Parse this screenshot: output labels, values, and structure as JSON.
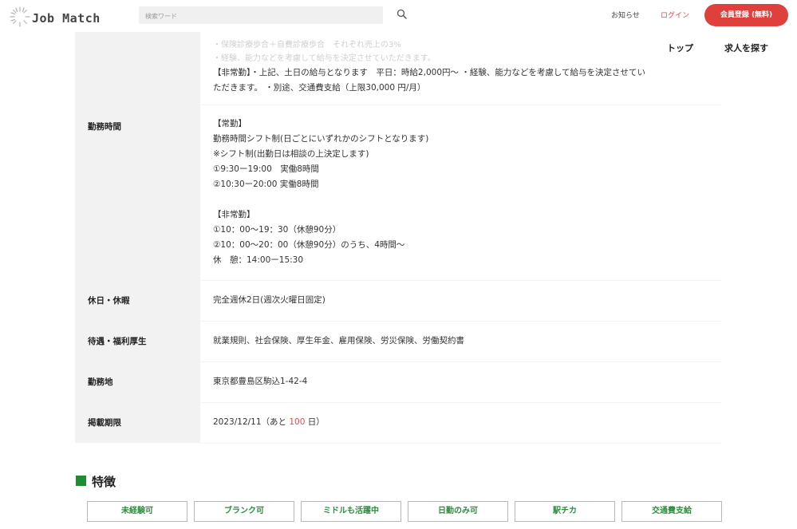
{
  "header": {
    "logo_text": "Job Match",
    "search_placeholder": "検索ワード",
    "notice_label": "お知らせ",
    "login_label": "ログイン",
    "signup_label": "会員登録 (無料)",
    "icons": [
      "sunburst-logo-icon",
      "search-icon"
    ]
  },
  "subnav": {
    "top_label": "トップ",
    "jobs_label": "求人を探す"
  },
  "details": {
    "salary": {
      "faded_lines": [
        "・保険診療歩合＋自費診療歩合　それぞれ売上の3%",
        "・経験、能力などを考慮して給与を決定させていただきます。"
      ],
      "lines": [
        "【非常勤】・上記、土日の給与となります　平日：時給2,000円〜 ・経験、能力などを考慮して給与を決定させてい",
        "ただきます。 ・別途、交通費支給（上限30,000 円/月）"
      ]
    },
    "hours": {
      "label": "勤務時間",
      "lines": [
        "【常勤】",
        "勤務時間シフト制(日ごとにいずれかのシフトとなります)",
        "※シフト制(出勤日は相談の上決定します)",
        "①9:30ー19:00　実働8時間",
        "②10:30ー20:00 実働8時間",
        "",
        "【非常勤】",
        "①10：00〜19：30（休憩90分）",
        "②10：00〜20：00（休憩90分）のうち、4時間〜",
        "休　憩：14:00ー15:30"
      ]
    },
    "holidays": {
      "label": "休日・休暇",
      "value": "完全週休2日(週次火曜日固定)"
    },
    "benefits": {
      "label": "待遇・福利厚生",
      "value": "就業規則、社会保険、厚生年金、雇用保険、労災保険、労働契約書"
    },
    "location": {
      "label": "勤務地",
      "value": "東京都豊島区駒込1-42-4"
    },
    "period": {
      "label": "掲載期限",
      "date": "2023/12/11",
      "prefix": "（あと ",
      "days": "100",
      "suffix": " 日）"
    }
  },
  "features": {
    "title": "特徴",
    "tags": [
      "未経験可",
      "ブランク可",
      "ミドルも活躍中",
      "日勤のみ可",
      "駅チカ",
      "交通費支給"
    ]
  },
  "colors": {
    "accent_red": "#e0403c",
    "feature_green": "#1f8c33",
    "tag_text_green": "#2e8b3e",
    "label_bg": "#f2f2f2"
  }
}
